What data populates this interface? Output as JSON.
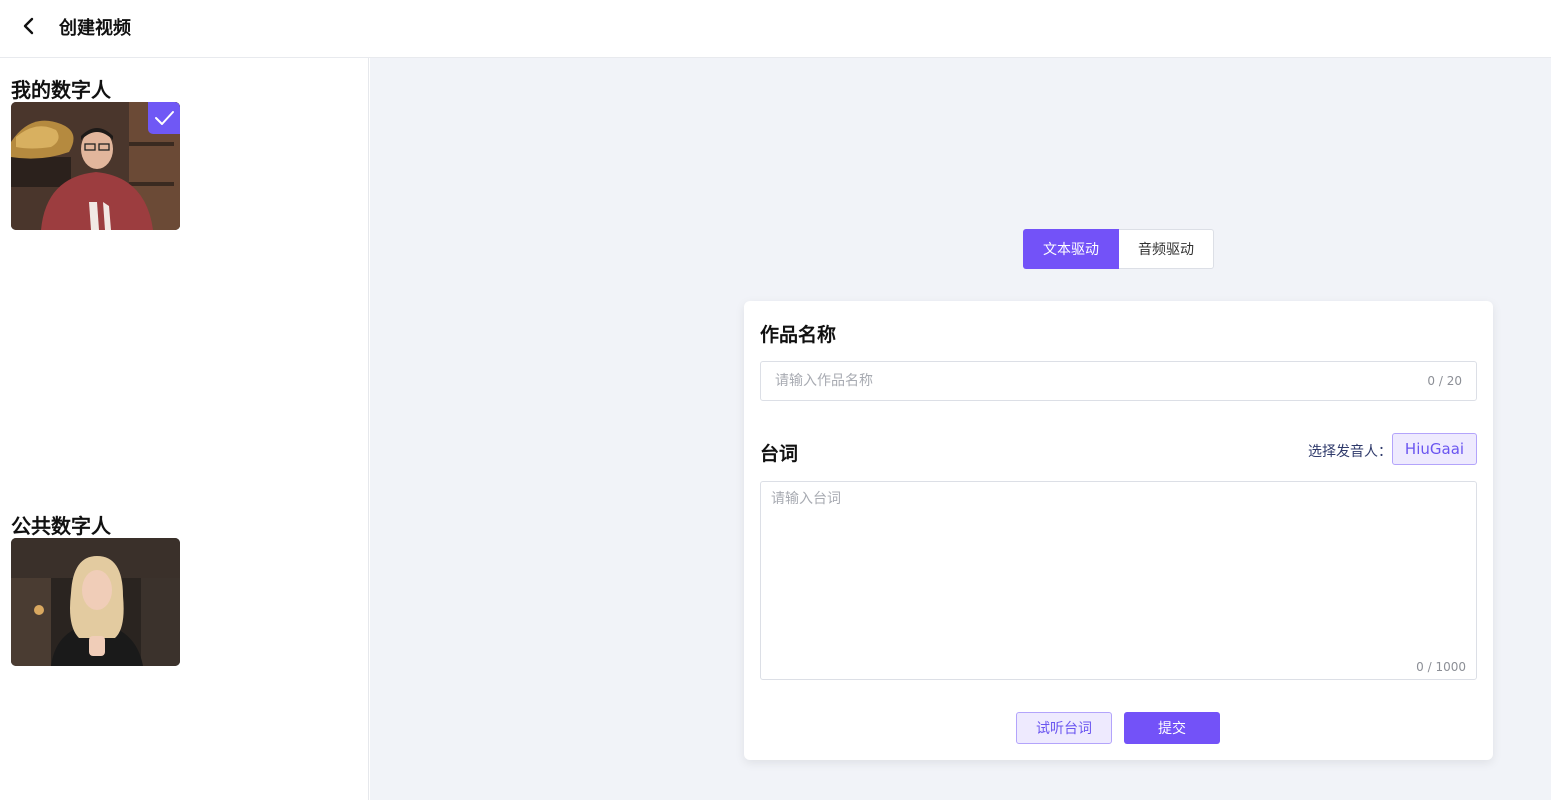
{
  "header": {
    "title": "创建视频",
    "back_icon": "chevron-left-icon"
  },
  "sidebar": {
    "my_section_title": "我的数字人",
    "public_section_title": "公共数字人"
  },
  "mode_tabs": [
    {
      "label": "文本驱动",
      "active": true
    },
    {
      "label": "音频驱动",
      "active": false
    }
  ],
  "form": {
    "name_label": "作品名称",
    "name_placeholder": "请输入作品名称",
    "name_value": "",
    "name_counter": "0 / 20",
    "script_label": "台词",
    "speaker_label": "选择发音人：",
    "speaker_value": "HiuGaai",
    "script_placeholder": "请输入台词",
    "script_value": "",
    "script_counter": "0 / 1000",
    "preview_button": "试听台词",
    "submit_button": "提交"
  },
  "colors": {
    "accent": "#7352f8",
    "accent_light": "#eeeafe",
    "main_bg": "#f1f3f8"
  }
}
